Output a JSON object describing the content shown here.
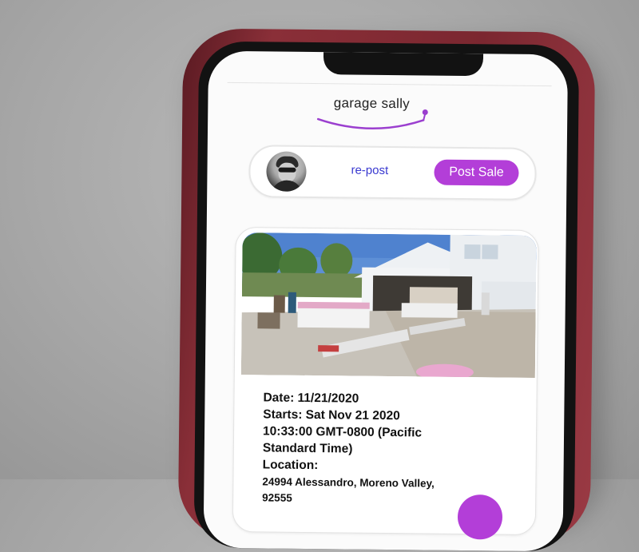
{
  "app": {
    "logo_text": "garage sally",
    "accent_color": "#b33ed8"
  },
  "header": {
    "avatar_icon": "user-avatar",
    "repost_label": "re-post",
    "post_sale_label": "Post Sale"
  },
  "listing": {
    "photo": "garage-sale-driveway-photo",
    "date_line": "Date: 11/21/2020",
    "starts_line1": "Starts: Sat Nov 21 2020",
    "starts_line2": "10:33:00 GMT-0800 (Pacific",
    "starts_line3": "Standard Time)",
    "location_label": "Location:",
    "address_line1": "24994 Alessandro, Moreno Valley,",
    "address_line2": "92555"
  },
  "fab_icon": "add-icon"
}
